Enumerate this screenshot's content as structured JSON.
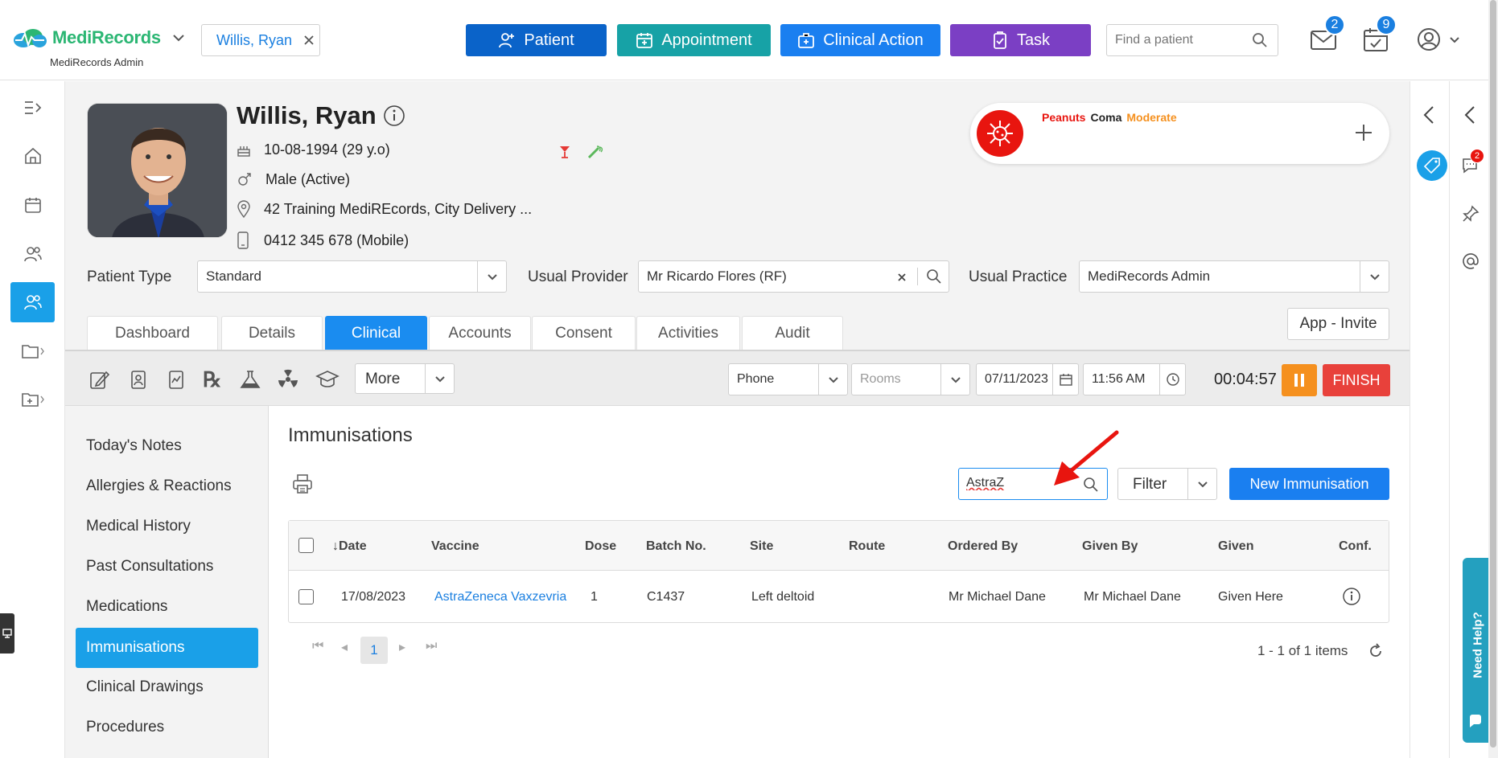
{
  "app": {
    "brand": "MediRecords",
    "sub_brand": "MediRecords Admin"
  },
  "header": {
    "patient_chip": "Willis, Ryan",
    "buttons": {
      "patient": "Patient",
      "appointment": "Appointment",
      "clinical_action": "Clinical Action",
      "task": "Task"
    },
    "search_placeholder": "Find a patient",
    "mail_count": "2",
    "tasks_count": "9"
  },
  "patient": {
    "name": "Willis, Ryan",
    "dob": "10-08-1994 (29 y.o)",
    "gender": "Male (Active)",
    "address": "42 Training MediREcords, City Delivery ...",
    "phone": "0412 345 678 (Mobile)",
    "allergy": {
      "substance": "Peanuts",
      "reaction": "Coma",
      "severity": "Moderate"
    },
    "patient_type_label": "Patient Type",
    "patient_type": "Standard",
    "usual_provider_label": "Usual Provider",
    "usual_provider": "Mr Ricardo Flores (RF)",
    "usual_practice_label": "Usual Practice",
    "usual_practice": "MediRecords Admin"
  },
  "tabs": [
    "Dashboard",
    "Details",
    "Clinical",
    "Accounts",
    "Consent",
    "Activities",
    "Audit"
  ],
  "app_invite": "App - Invite",
  "toolbar": {
    "more": "More",
    "contact_type": "Phone",
    "rooms_placeholder": "Rooms",
    "date": "07/11/2023",
    "time": "11:56 AM",
    "timer": "00:04:57",
    "finish": "FINISH"
  },
  "clinical_nav": [
    "Today's Notes",
    "Allergies & Reactions",
    "Medical History",
    "Past Consultations",
    "Medications",
    "Immunisations",
    "Clinical Drawings",
    "Procedures"
  ],
  "immunisations": {
    "title": "Immunisations",
    "search_value": "AstraZ",
    "filter": "Filter",
    "new_button": "New Immunisation",
    "columns": [
      "Date",
      "Vaccine",
      "Dose",
      "Batch No.",
      "Site",
      "Route",
      "Ordered By",
      "Given By",
      "Given",
      "Conf."
    ],
    "rows": [
      {
        "date": "17/08/2023",
        "vaccine": "AstraZeneca Vaxzevria",
        "dose": "1",
        "batch": "C1437",
        "site": "Left deltoid",
        "route": "",
        "ordered_by": "Mr Michael Dane",
        "given_by": "Mr Michael Dane",
        "given": "Given Here"
      }
    ],
    "current_page": "1",
    "items_summary": "1 - 1 of 1 items"
  },
  "help_tab": "Need Help?",
  "chat_count": "2",
  "colors": {
    "patient_btn": "#0a63c9",
    "appointment_btn": "#17a2a6",
    "clinical_btn": "#1a7ff0",
    "task_btn": "#7b3fc4",
    "accent": "#1a8cf0",
    "pause": "#f5901e",
    "finish": "#e8413b",
    "nav_active": "#1aa0e8"
  }
}
